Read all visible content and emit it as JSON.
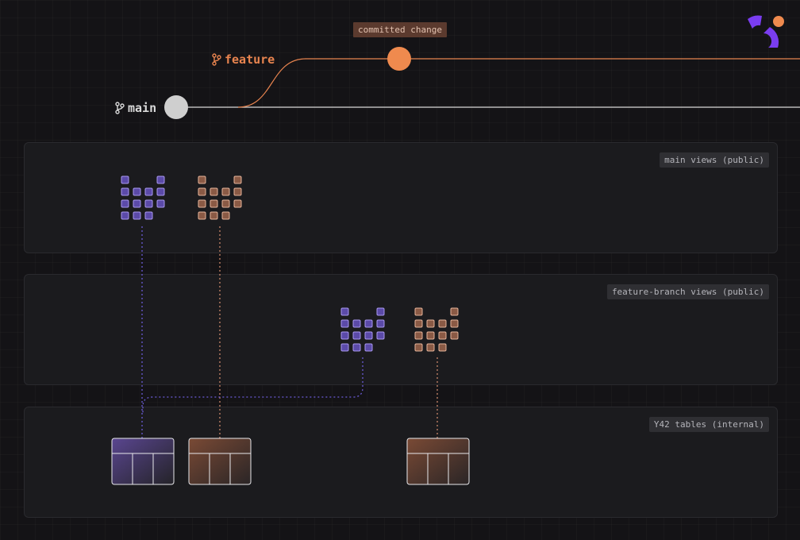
{
  "branches": {
    "main": {
      "label": "main",
      "color": "#d9d9d9",
      "icon": "git-branch-icon"
    },
    "feature": {
      "label": "feature",
      "color": "#e8844f",
      "icon": "git-branch-icon"
    }
  },
  "commit": {
    "label": "committed change",
    "color": "#ef8a4e"
  },
  "panels": {
    "main_views": {
      "label": "main views (public)"
    },
    "feature_views": {
      "label": "feature-branch views (public)"
    },
    "tables": {
      "label": "Y42 tables (internal)"
    }
  },
  "colors": {
    "purple": "#8b6bd6",
    "orange": "#c9876a",
    "logo_purple": "#7a3df0",
    "logo_orange": "#ef8a4e"
  },
  "logo": {
    "name": "y42-logo"
  }
}
